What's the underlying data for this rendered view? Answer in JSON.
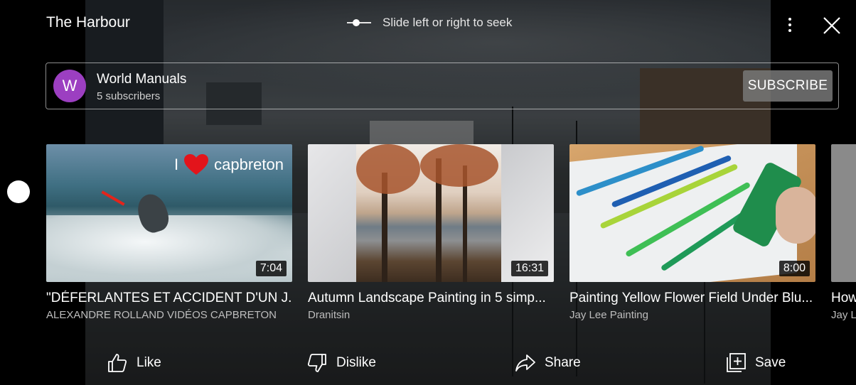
{
  "header": {
    "title": "The Harbour",
    "seek_hint": "Slide left or right to seek"
  },
  "channel": {
    "avatar_letter": "W",
    "avatar_color": "#9c3fc1",
    "name": "World Manuals",
    "subscribers": "5 subscribers",
    "subscribe_label": "SUBSCRIBE"
  },
  "videos": [
    {
      "title": "\"DÉFERLANTES ET ACCIDENT D'UN J...",
      "channel": "ALEXANDRE ROLLAND VIDÉOS CAPBRETON",
      "duration": "7:04",
      "thumb_caption": "capbreton",
      "thumb_caption_prefix": "I"
    },
    {
      "title": "Autumn Landscape Painting in 5 simp...",
      "channel": "Dranitsin",
      "duration": "16:31"
    },
    {
      "title": "Painting Yellow Flower Field Under Blu...",
      "channel": "Jay Lee Painting",
      "duration": "8:00"
    },
    {
      "title": "How",
      "channel": "Jay L"
    }
  ],
  "actions": {
    "like": "Like",
    "dislike": "Dislike",
    "share": "Share",
    "save": "Save"
  },
  "icons": {
    "more": "more-vert-icon",
    "close": "close-icon",
    "seek": "seek-slider-icon",
    "like": "thumbs-up-icon",
    "dislike": "thumbs-down-icon",
    "share": "share-arrow-icon",
    "save": "add-to-playlist-icon"
  }
}
